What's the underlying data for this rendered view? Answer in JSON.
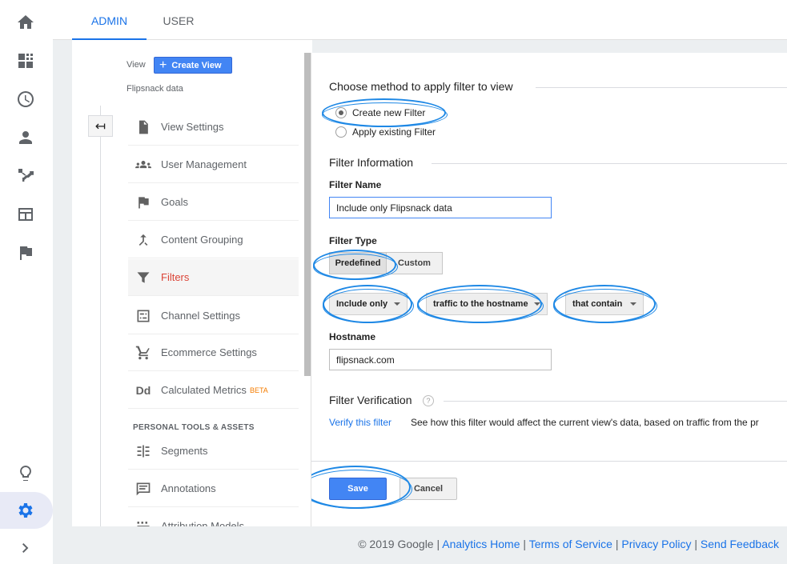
{
  "tabs": [
    {
      "label": "ADMIN",
      "active": true
    },
    {
      "label": "USER",
      "active": false
    }
  ],
  "rail": {
    "icons": [
      "home-icon",
      "dashboard-icon",
      "clock-icon",
      "person-icon",
      "acquisition-icon",
      "behavior-icon",
      "flag-icon",
      "lightbulb-icon",
      "settings-icon",
      "expand-icon"
    ]
  },
  "view": {
    "label": "View",
    "create_view": "Create View",
    "name": "Flipsnack data"
  },
  "nav": {
    "items": [
      {
        "label": "View Settings",
        "icon": "document-icon"
      },
      {
        "label": "User Management",
        "icon": "people-icon"
      },
      {
        "label": "Goals",
        "icon": "flag-icon"
      },
      {
        "label": "Content Grouping",
        "icon": "merge-icon"
      },
      {
        "label": "Filters",
        "icon": "funnel-icon",
        "selected": true
      },
      {
        "label": "Channel Settings",
        "icon": "channel-icon"
      },
      {
        "label": "Ecommerce Settings",
        "icon": "cart-icon"
      },
      {
        "label": "Calculated Metrics",
        "icon": "dd-icon",
        "badge": "BETA"
      }
    ],
    "section_title": "PERSONAL TOOLS & ASSETS",
    "personal_items": [
      {
        "label": "Segments",
        "icon": "segments-icon"
      },
      {
        "label": "Annotations",
        "icon": "comment-icon"
      },
      {
        "label": "Attribution Models",
        "icon": "attribution-icon"
      }
    ]
  },
  "form": {
    "method_title": "Choose method to apply filter to view",
    "method_options": [
      {
        "label": "Create new Filter",
        "checked": true
      },
      {
        "label": "Apply existing Filter",
        "checked": false
      }
    ],
    "info_title": "Filter Information",
    "name_label": "Filter Name",
    "name_value": "Include only Flipsnack data",
    "type_label": "Filter Type",
    "type_options": [
      "Predefined",
      "Custom"
    ],
    "dropdowns": [
      "Include only",
      "traffic to the hostname",
      "that contain"
    ],
    "hostname_label": "Hostname",
    "hostname_value": "flipsnack.com",
    "verification_title": "Filter Verification",
    "help_glyph": "?",
    "verify_link": "Verify this filter",
    "verify_desc": "See how this filter would affect the current view's data, based on traffic from the pr",
    "save": "Save",
    "cancel": "Cancel"
  },
  "footer": {
    "copyright": "© 2019 Google",
    "sep": "|",
    "links": [
      "Analytics Home",
      "Terms of Service",
      "Privacy Policy",
      "Send Feedback"
    ]
  },
  "colors": {
    "accent": "#1a73e8",
    "button_blue": "#4285f4",
    "selected_nav": "#db4437",
    "annotation_ring": "#1e88e5",
    "beta": "#f57c00"
  }
}
